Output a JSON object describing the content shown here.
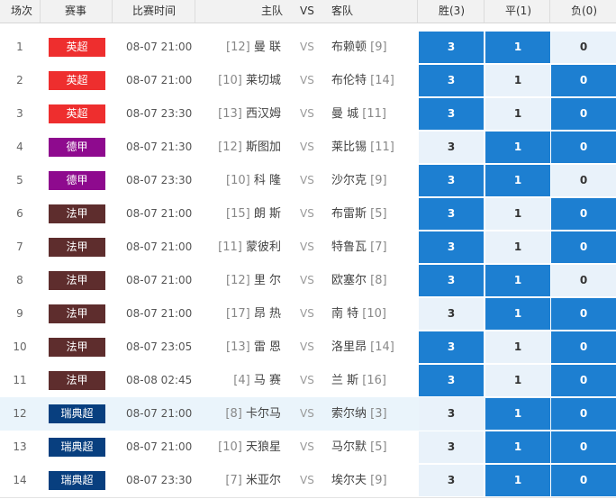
{
  "header": {
    "col_no": "场次",
    "col_league": "赛事",
    "col_time": "比赛时间",
    "col_home": "主队",
    "col_vs": "VS",
    "col_away": "客队",
    "col_win": "胜(3)",
    "col_draw": "平(1)",
    "col_lose": "负(0)"
  },
  "colors": {
    "英超": "#ee2e2e",
    "德甲": "#8e0a8e",
    "法甲": "#5e2d2d",
    "瑞典超": "#083f7f",
    "selected": "#1d7fd1",
    "unselected": "#e9f2fa",
    "highlight_row": "#eaf4fb"
  },
  "odds_values": {
    "win": "3",
    "draw": "1",
    "lose": "0"
  },
  "vs_label": "VS",
  "matches": [
    {
      "no": "1",
      "league": "英超",
      "time": "08-07 21:00",
      "home_rank": "[12]",
      "home": "曼 联",
      "away": "布赖顿",
      "away_rank": "[9]",
      "win": true,
      "draw": true,
      "lose": false,
      "highlight": false
    },
    {
      "no": "2",
      "league": "英超",
      "time": "08-07 21:00",
      "home_rank": "[10]",
      "home": "莱切城",
      "away": "布伦特",
      "away_rank": "[14]",
      "win": true,
      "draw": false,
      "lose": true,
      "highlight": false
    },
    {
      "no": "3",
      "league": "英超",
      "time": "08-07 23:30",
      "home_rank": "[13]",
      "home": "西汉姆",
      "away": "曼 城",
      "away_rank": "[11]",
      "win": true,
      "draw": false,
      "lose": true,
      "highlight": false
    },
    {
      "no": "4",
      "league": "德甲",
      "time": "08-07 21:30",
      "home_rank": "[12]",
      "home": "斯图加",
      "away": "莱比锡",
      "away_rank": "[11]",
      "win": false,
      "draw": true,
      "lose": true,
      "highlight": false
    },
    {
      "no": "5",
      "league": "德甲",
      "time": "08-07 23:30",
      "home_rank": "[10]",
      "home": "科 隆",
      "away": "沙尔克",
      "away_rank": "[9]",
      "win": true,
      "draw": true,
      "lose": false,
      "highlight": false
    },
    {
      "no": "6",
      "league": "法甲",
      "time": "08-07 21:00",
      "home_rank": "[15]",
      "home": "朗 斯",
      "away": "布雷斯",
      "away_rank": "[5]",
      "win": true,
      "draw": false,
      "lose": true,
      "highlight": false
    },
    {
      "no": "7",
      "league": "法甲",
      "time": "08-07 21:00",
      "home_rank": "[11]",
      "home": "蒙彼利",
      "away": "特鲁瓦",
      "away_rank": "[7]",
      "win": true,
      "draw": false,
      "lose": true,
      "highlight": false
    },
    {
      "no": "8",
      "league": "法甲",
      "time": "08-07 21:00",
      "home_rank": "[12]",
      "home": "里 尔",
      "away": "欧塞尔",
      "away_rank": "[8]",
      "win": true,
      "draw": true,
      "lose": false,
      "highlight": false
    },
    {
      "no": "9",
      "league": "法甲",
      "time": "08-07 21:00",
      "home_rank": "[17]",
      "home": "昂 热",
      "away": "南 特",
      "away_rank": "[10]",
      "win": false,
      "draw": true,
      "lose": true,
      "highlight": false
    },
    {
      "no": "10",
      "league": "法甲",
      "time": "08-07 23:05",
      "home_rank": "[13]",
      "home": "雷 恩",
      "away": "洛里昂",
      "away_rank": "[14]",
      "win": true,
      "draw": false,
      "lose": true,
      "highlight": false
    },
    {
      "no": "11",
      "league": "法甲",
      "time": "08-08 02:45",
      "home_rank": "[4]",
      "home": "马 赛",
      "away": "兰 斯",
      "away_rank": "[16]",
      "win": true,
      "draw": false,
      "lose": true,
      "highlight": false
    },
    {
      "no": "12",
      "league": "瑞典超",
      "time": "08-07 21:00",
      "home_rank": "[8]",
      "home": "卡尔马",
      "away": "索尔纳",
      "away_rank": "[3]",
      "win": false,
      "draw": true,
      "lose": true,
      "highlight": true
    },
    {
      "no": "13",
      "league": "瑞典超",
      "time": "08-07 21:00",
      "home_rank": "[10]",
      "home": "天狼星",
      "away": "马尔默",
      "away_rank": "[5]",
      "win": false,
      "draw": true,
      "lose": true,
      "highlight": false
    },
    {
      "no": "14",
      "league": "瑞典超",
      "time": "08-07 23:30",
      "home_rank": "[7]",
      "home": "米亚尔",
      "away": "埃尔夫",
      "away_rank": "[9]",
      "win": false,
      "draw": true,
      "lose": true,
      "highlight": false
    }
  ]
}
